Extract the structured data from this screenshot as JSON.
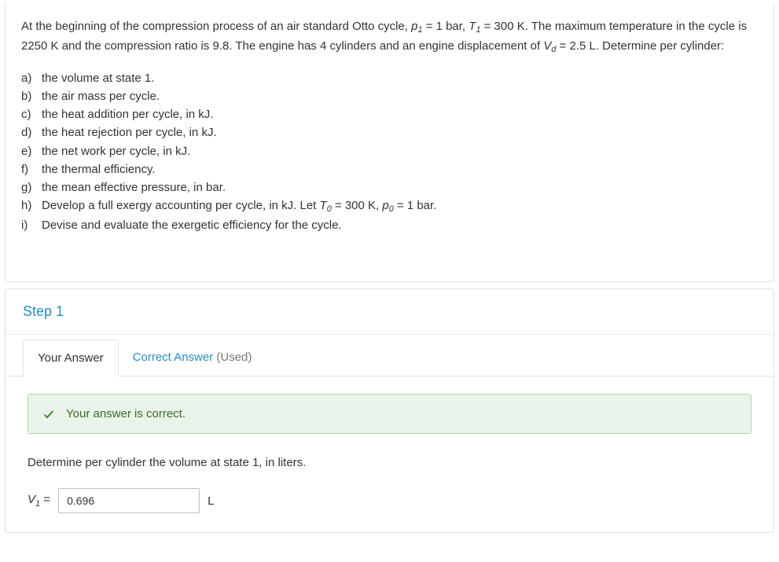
{
  "question": {
    "intro_pre": "At the beginning of the compression process of an air standard Otto cycle, ",
    "p1_var": "p",
    "p1_sub": "1",
    "p1_val": " = 1 bar, ",
    "t1_var": "T",
    "t1_sub": "1",
    "t1_val": " = 300 K. The maximum temperature in the cycle is 2250 K and the compression ratio is 9.8. The engine has 4 cylinders and an engine displacement of ",
    "vd_var": "V",
    "vd_sub": "d",
    "vd_val": " = 2.5 L.  Determine per cylinder:",
    "items": [
      {
        "label": "a)",
        "text": "the volume at state 1."
      },
      {
        "label": "b)",
        "text": "the air mass per cycle."
      },
      {
        "label": "c)",
        "text": "the heat addition per cycle, in kJ."
      },
      {
        "label": "d)",
        "text": "the heat rejection per cycle, in kJ."
      },
      {
        "label": "e)",
        "text": "the net work per cycle, in kJ."
      },
      {
        "label": "f)",
        "text": "the thermal efficiency."
      },
      {
        "label": "g)",
        "text": "the mean effective pressure, in bar."
      }
    ],
    "item_h": {
      "label": "h)",
      "pre": "Develop a full exergy accounting per cycle, in kJ. Let ",
      "t0_var": "T",
      "t0_sub": "0",
      "t0_val": " = 300 K, ",
      "p0_var": "p",
      "p0_sub": "0",
      "p0_val": " = 1 bar."
    },
    "item_i": {
      "label": "i)",
      "text": "Devise and evaluate the exergetic efficiency for the cycle."
    }
  },
  "step": {
    "title": "Step 1",
    "tabs": {
      "your_answer": "Your Answer",
      "correct_answer": "Correct Answer",
      "used": " (Used)"
    },
    "feedback": "Your answer is correct.",
    "prompt": "Determine per cylinder the volume at state 1, in liters.",
    "answer": {
      "var": "V",
      "sub": "1",
      "eq": " = ",
      "value": "0.696",
      "unit": "L"
    }
  }
}
